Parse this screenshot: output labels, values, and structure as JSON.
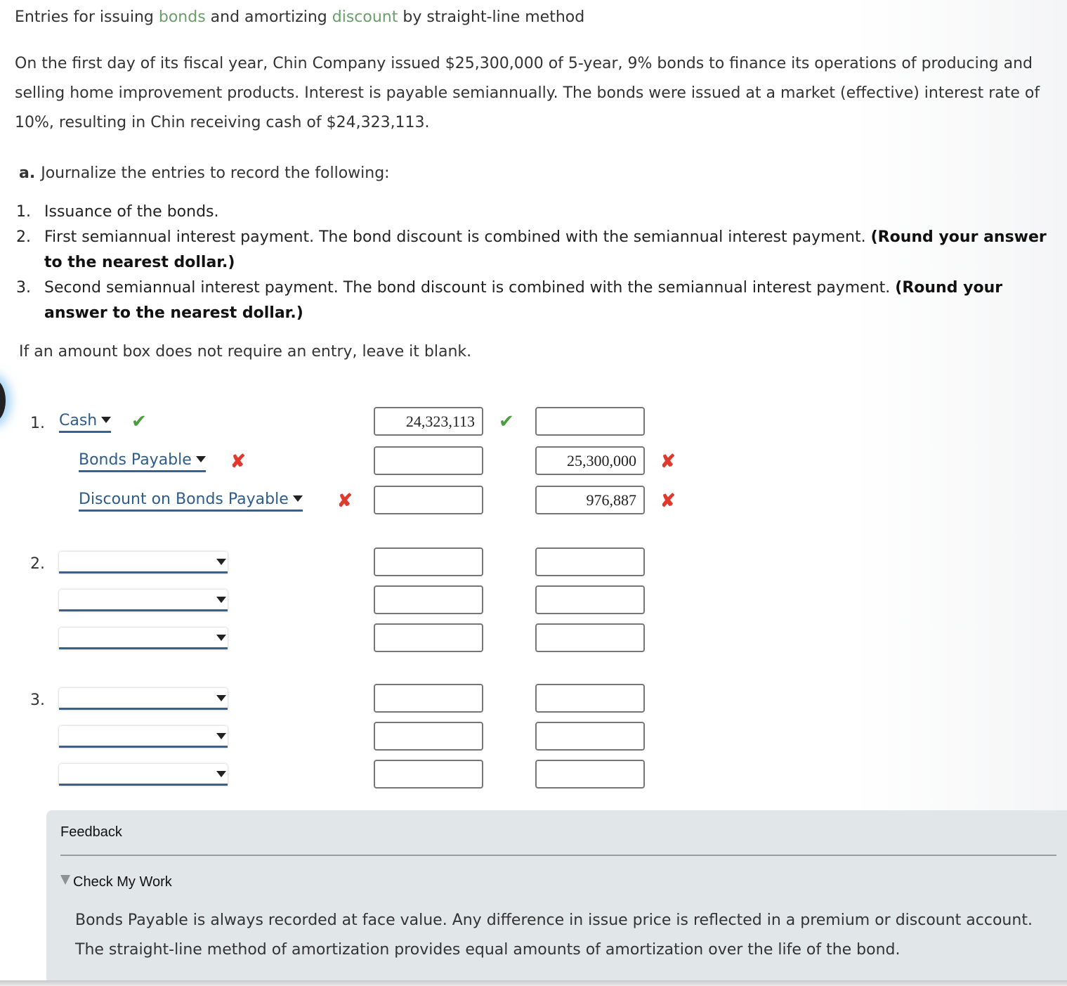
{
  "title": {
    "prefix": "Entries for issuing ",
    "kw1": "bonds",
    "mid": " and amortizing ",
    "kw2": "discount",
    "suffix": " by straight-line method"
  },
  "intro": "On the first day of its fiscal year, Chin Company issued $25,300,000 of 5-year, 9% bonds to finance its operations of producing and selling home improvement products. Interest is payable semiannually. The bonds were issued at a market (effective) interest rate of 10%, resulting in Chin receiving cash of $24,323,113.",
  "part_a": {
    "label": "a.",
    "text": "Journalize the entries to record the following:"
  },
  "steps": [
    {
      "num": "1.",
      "text": "Issuance of the bonds.",
      "bold": ""
    },
    {
      "num": "2.",
      "text": "First semiannual interest payment. The bond discount is combined with the semiannual interest payment. ",
      "bold": "(Round your answer to the nearest dollar.)"
    },
    {
      "num": "3.",
      "text": "Second semiannual interest payment. The bond discount is combined with the semiannual interest payment. ",
      "bold": "(Round your answer to the nearest dollar.)"
    }
  ],
  "blank_note": "If an amount box does not require an entry, leave it blank.",
  "entries": [
    {
      "num": "1.",
      "lines": [
        {
          "account": "Cash",
          "account_status": "correct",
          "debit": "24,323,113",
          "debit_status": "correct",
          "credit": "",
          "credit_status": ""
        },
        {
          "account": "Bonds Payable",
          "account_status": "incorrect",
          "debit": "",
          "debit_status": "",
          "credit": "25,300,000",
          "credit_status": "incorrect"
        },
        {
          "account": "Discount on Bonds Payable",
          "account_status": "incorrect",
          "debit": "",
          "debit_status": "",
          "credit": "976,887",
          "credit_status": "incorrect"
        }
      ]
    },
    {
      "num": "2.",
      "lines": [
        {
          "account": "",
          "debit": "",
          "credit": ""
        },
        {
          "account": "",
          "debit": "",
          "credit": ""
        },
        {
          "account": "",
          "debit": "",
          "credit": ""
        }
      ]
    },
    {
      "num": "3.",
      "lines": [
        {
          "account": "",
          "debit": "",
          "credit": ""
        },
        {
          "account": "",
          "debit": "",
          "credit": ""
        },
        {
          "account": "",
          "debit": "",
          "credit": ""
        }
      ]
    }
  ],
  "status_icons": {
    "correct": "✔",
    "incorrect": "✘"
  },
  "status_colors": {
    "correct": "#4a9e3f",
    "incorrect": "#e03a2e"
  },
  "feedback": {
    "title": "Feedback",
    "toggle": "Check My Work",
    "text": "Bonds Payable is always recorded at face value. Any difference in issue price is reflected in a premium or discount account. The straight-line method of amortization provides equal amounts of amortization over the life of the bond."
  }
}
